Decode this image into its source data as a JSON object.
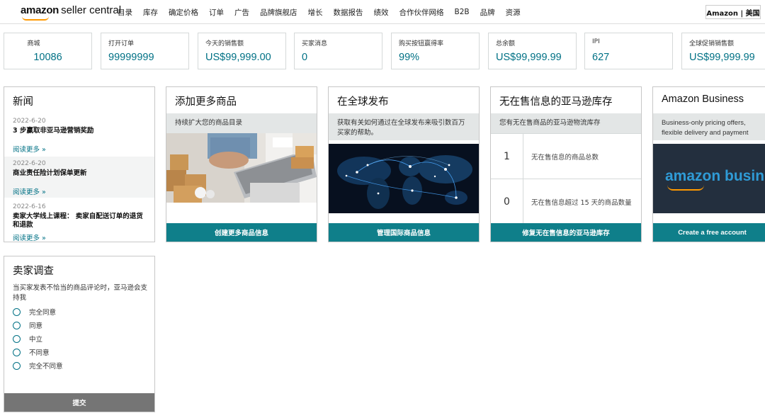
{
  "header": {
    "logo_brand": "amazon",
    "logo_suffix": "seller central",
    "nav": [
      "目录",
      "库存",
      "确定价格",
      "订单",
      "广告",
      "品牌旗舰店",
      "增长",
      "数据报告",
      "绩效",
      "合作伙伴网络",
      "B2B",
      "品牌",
      "资源"
    ],
    "region": "Amazon | 美国"
  },
  "metrics": [
    {
      "label": "商城",
      "value": "10086"
    },
    {
      "label": "打开订单",
      "value": "99999999"
    },
    {
      "label": "今天的销售额",
      "value": "US$99,999.00"
    },
    {
      "label": "买家消息",
      "value": "0"
    },
    {
      "label": "购买按钮赢得率",
      "value": "99%"
    },
    {
      "label": "总余额",
      "value": "US$99,999.99"
    },
    {
      "label": "IPI",
      "value": "627"
    },
    {
      "label": "全球促销销售额",
      "value": "US$99,999.99"
    }
  ],
  "news": {
    "title": "新闻",
    "items": [
      {
        "date": "2022-6-20",
        "headline": "3 步赢取非亚马逊营销奖励",
        "link": "阅读更多 »"
      },
      {
        "date": "2022-6-20",
        "headline": "商业责任险计划保单更新",
        "link": "阅读更多 »"
      },
      {
        "date": "2022-6-16",
        "headline": "卖家大学线上课程： 卖家自配送订单的退货和退款",
        "link": "阅读更多 »"
      }
    ]
  },
  "add_products": {
    "title": "添加更多商品",
    "subtitle": "持续扩大您的商品目录",
    "button": "创建更多商品信息"
  },
  "global": {
    "title": "在全球发布",
    "subtitle": "获取有关如何通过在全球发布来吸引数百万买家的帮助。",
    "button": "管理国际商品信息"
  },
  "stranded": {
    "title": "无在售信息的亚马逊库存",
    "subtitle": "您有无在售商品的亚马逊物流库存",
    "rows": [
      {
        "count": "1",
        "label": "无在售信息的商品总数"
      },
      {
        "count": "0",
        "label": "无在售信息超过 15 天的商品数量"
      }
    ],
    "button": "修复无在售信息的亚马逊库存"
  },
  "business": {
    "title": "Amazon Business",
    "subtitle": "Business-only pricing offers, flexible delivery and payment",
    "banner_text": "amazon busin",
    "button": "Create a free account"
  },
  "survey": {
    "title": "卖家调查",
    "question": "当买家发表不恰当的商品评论时，亚马逊会支持我",
    "options": [
      "完全同意",
      "同意",
      "中立",
      "不同意",
      "完全不同意"
    ],
    "button": "提交"
  },
  "colors": {
    "accent": "#0f7f8a",
    "link": "#007185",
    "subheader": "#e3e6e6",
    "submit": "#757575",
    "smile": "#ff9900"
  }
}
